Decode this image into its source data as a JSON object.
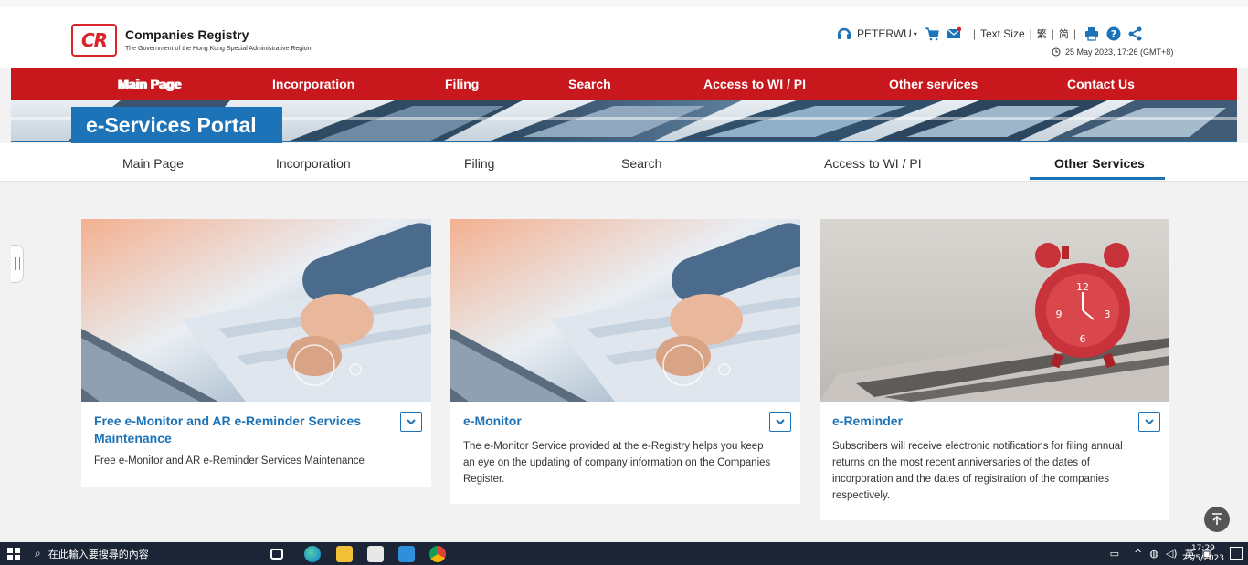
{
  "header": {
    "logo_text": "CR",
    "org_name": "Companies Registry",
    "org_sub": "The Government of the Hong Kong Special Administrative Region",
    "user": "PETERWU",
    "text_size_label": "Text Size",
    "lang_trad": "繁",
    "lang_simp": "简",
    "datetime": "25 May 2023, 17:26 (GMT+8)"
  },
  "main_nav": [
    "Main Page",
    "Incorporation",
    "Filing",
    "Search",
    "Access to WI / PI",
    "Other services",
    "Contact Us"
  ],
  "portal_title": "e-Services Portal",
  "sub_nav": [
    "Main Page",
    "Incorporation",
    "Filing",
    "Search",
    "Access to WI / PI",
    "Other Services"
  ],
  "sub_nav_active": "Other Services",
  "cards": [
    {
      "title": "Free e-Monitor and AR e-Reminder Services Maintenance",
      "desc": "Free e-Monitor and AR e-Reminder Services Maintenance"
    },
    {
      "title": "e-Monitor",
      "desc": "The e-Monitor Service provided at the e-Registry helps you keep an eye on the updating of company information on the Companies Register."
    },
    {
      "title": "e-Reminder",
      "desc": "Subscribers will receive electronic notifications for filing annual returns on the most recent anniversaries of the dates of incorporation and the dates of registration of the companies respectively."
    }
  ],
  "taskbar": {
    "search_placeholder": "在此輸入要搜尋的內容",
    "ime": "英",
    "time": "17:29",
    "date": "25/5/2023"
  },
  "colors": {
    "brand_red": "#c9171e",
    "brand_blue": "#1d73b8"
  }
}
